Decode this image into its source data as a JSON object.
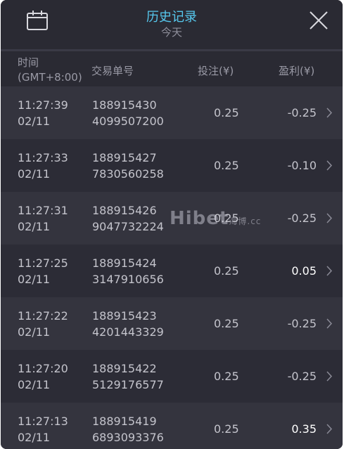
{
  "header": {
    "title": "历史记录",
    "subtitle": "今天",
    "calendar_icon": "calendar-icon",
    "close_icon": "close-icon"
  },
  "columns": {
    "time_line1": "时间",
    "time_line2": "(GMT+8:00)",
    "order": "交易单号",
    "bet": "投注(¥)",
    "profit": "盈利(¥)"
  },
  "rows": [
    {
      "time": "11:27:39",
      "date": "02/11",
      "order1": "188915430",
      "order2": "4099507200",
      "bet": "0.25",
      "profit": "-0.25"
    },
    {
      "time": "11:27:33",
      "date": "02/11",
      "order1": "188915427",
      "order2": "7830560258",
      "bet": "0.25",
      "profit": "-0.10"
    },
    {
      "time": "11:27:31",
      "date": "02/11",
      "order1": "188915426",
      "order2": "9047732224",
      "bet": "0.25",
      "profit": "-0.25"
    },
    {
      "time": "11:27:25",
      "date": "02/11",
      "order1": "188915424",
      "order2": "3147910656",
      "bet": "0.25",
      "profit": "0.05"
    },
    {
      "time": "11:27:22",
      "date": "02/11",
      "order1": "188915423",
      "order2": "4201443329",
      "bet": "0.25",
      "profit": "-0.25"
    },
    {
      "time": "11:27:20",
      "date": "02/11",
      "order1": "188915422",
      "order2": "5129176577",
      "bet": "0.25",
      "profit": "-0.25"
    },
    {
      "time": "11:27:13",
      "date": "02/11",
      "order1": "188915419",
      "order2": "6893093376",
      "bet": "0.25",
      "profit": "0.35"
    }
  ],
  "watermark": {
    "text": "Hibet",
    "sub": "海博",
    "suffix": ".cc"
  },
  "colors": {
    "accent": "#56c8ee",
    "positive": "#ffffff",
    "negative": "#c4c4cc"
  }
}
